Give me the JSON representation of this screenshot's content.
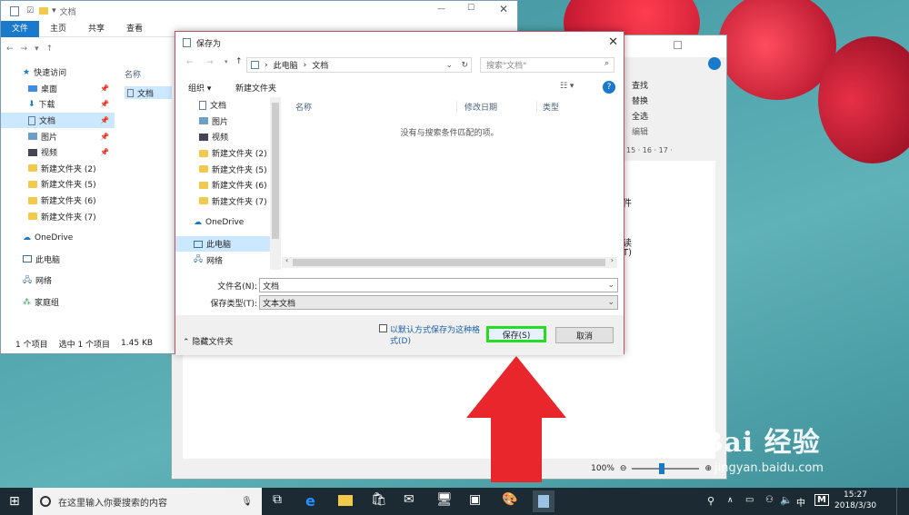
{
  "explorer": {
    "title": "文档",
    "tabs": [
      "文件",
      "主页",
      "共享",
      "查看"
    ],
    "content_header": "名称",
    "file_name": "文档",
    "nav": [
      {
        "label": "快速访问",
        "icon": "star-icon"
      },
      {
        "label": "桌面",
        "icon": "desktop-icon"
      },
      {
        "label": "下载",
        "icon": "download-icon"
      },
      {
        "label": "文档",
        "icon": "document-icon"
      },
      {
        "label": "图片",
        "icon": "picture-icon"
      },
      {
        "label": "视频",
        "icon": "video-icon"
      },
      {
        "label": "新建文件夹 (2)",
        "icon": "folder-icon"
      },
      {
        "label": "新建文件夹 (5)",
        "icon": "folder-icon"
      },
      {
        "label": "新建文件夹 (6)",
        "icon": "folder-icon"
      },
      {
        "label": "新建文件夹 (7)",
        "icon": "folder-icon"
      },
      {
        "label": "OneDrive",
        "icon": "cloud-icon"
      },
      {
        "label": "此电脑",
        "icon": "computer-icon"
      },
      {
        "label": "网络",
        "icon": "network-icon"
      },
      {
        "label": "家庭组",
        "icon": "homegroup-icon"
      }
    ],
    "status": {
      "items": "1 个项目",
      "selected": "选中 1 个项目",
      "size": "1.45 KB"
    }
  },
  "bgwin": {
    "ribbon": [
      "查找",
      "替换",
      "全选"
    ],
    "group": "编辑",
    "ruler": "15 · 16 · 17 ·",
    "text_fragments": [
      "件",
      "读",
      "T)"
    ],
    "zoom": "100%"
  },
  "dialog": {
    "title": "保存为",
    "breadcrumb": [
      "此电脑",
      "文档"
    ],
    "search_placeholder": "搜索\"文档\"",
    "toolbar": {
      "organize": "组织 ▾",
      "new_folder": "新建文件夹"
    },
    "nav": [
      {
        "label": "文档",
        "icon": "document-icon"
      },
      {
        "label": "图片",
        "icon": "picture-icon"
      },
      {
        "label": "视频",
        "icon": "video-icon"
      },
      {
        "label": "新建文件夹 (2)",
        "icon": "folder-icon"
      },
      {
        "label": "新建文件夹 (5)",
        "icon": "folder-icon"
      },
      {
        "label": "新建文件夹 (6)",
        "icon": "folder-icon"
      },
      {
        "label": "新建文件夹 (7)",
        "icon": "folder-icon"
      },
      {
        "label": "OneDrive",
        "icon": "cloud-icon"
      },
      {
        "label": "此电脑",
        "icon": "computer-icon"
      },
      {
        "label": "网络",
        "icon": "network-icon"
      }
    ],
    "columns": [
      "名称",
      "修改日期",
      "类型"
    ],
    "empty_message": "没有与搜索条件匹配的项。",
    "filename_label": "文件名(N):",
    "filename_value": "文档",
    "filetype_label": "保存类型(T):",
    "filetype_value": "文本文档",
    "checkbox_label_1": "以默认方式保存为这种格",
    "checkbox_label_2": "式(D)",
    "hide_folders": "隐藏文件夹",
    "save_button": "保存(S)",
    "cancel_button": "取消"
  },
  "taskbar": {
    "search_placeholder": "在这里输入你要搜索的内容",
    "ime": "中",
    "ime_mode": "M",
    "time": "15:27",
    "date": "2018/3/30"
  },
  "watermark": {
    "brand": "Bai 经验",
    "url": "jingyan.baidu.com"
  },
  "colors": {
    "accent": "#1979ca",
    "highlight": "#22dd22",
    "arrow": "#e8262b"
  }
}
